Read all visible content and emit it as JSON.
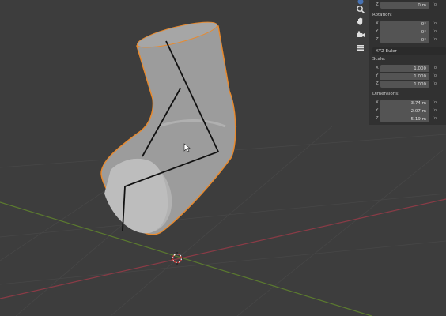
{
  "icons": {
    "top": "view-axis-icon",
    "zoom": "zoom-icon",
    "pan": "hand-icon",
    "camera": "camera-icon",
    "grid": "grid-icon"
  },
  "colors": {
    "viewport": "#3d3d3d",
    "selection_outline": "#e78a2f",
    "x_axis": "#8a3b46",
    "y_axis": "#5b7a2f",
    "mesh": "#9c9c9c"
  },
  "transform": {
    "location_z": {
      "axis": "Z",
      "value": "0 m"
    },
    "rotation_label": "Rotation:",
    "rotation": [
      {
        "axis": "X",
        "value": "0°",
        "unit": "‘o"
      },
      {
        "axis": "Y",
        "value": "0°",
        "unit": "‘o"
      },
      {
        "axis": "Z",
        "value": "0°",
        "unit": "‘o"
      }
    ],
    "rotation_mode": "XYZ Euler",
    "scale_label": "Scale:",
    "scale": [
      {
        "axis": "X",
        "value": "1.000",
        "unit": "‘o"
      },
      {
        "axis": "Y",
        "value": "1.000",
        "unit": "‘o"
      },
      {
        "axis": "Z",
        "value": "1.000",
        "unit": "‘o"
      }
    ],
    "dimensions_label": "Dimensions:",
    "dimensions": [
      {
        "axis": "X",
        "value": "3.74 m",
        "unit": "‘o"
      },
      {
        "axis": "Y",
        "value": "2.07 m",
        "unit": "‘o"
      },
      {
        "axis": "Z",
        "value": "5.19 m",
        "unit": "‘o"
      }
    ],
    "location_unit": "‘o"
  }
}
